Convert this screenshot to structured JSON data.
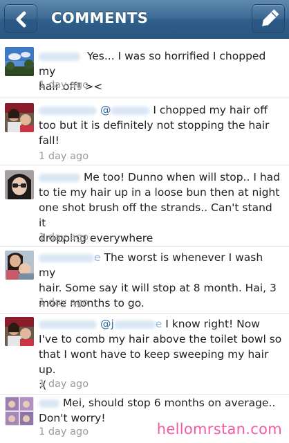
{
  "header": {
    "title": "COMMENTS",
    "back_icon": "chevron-left-icon",
    "edit_icon": "pencil-icon"
  },
  "colors": {
    "nav_bar": "#3b6a95",
    "timestamp": "#9a9a9a",
    "mention": "#2f6aa5",
    "watermark": "#f15aa6"
  },
  "comments": [
    {
      "text_lines": [
        "Yes... I was so horrified I chopped my",
        "hair off! ><"
      ],
      "time": "1 day ago"
    },
    {
      "mention": "@",
      "text_lines": [
        "I chopped my hair off",
        "too but it is definitely not stopping the hair",
        "fall!"
      ],
      "time": "1 day ago"
    },
    {
      "text_lines": [
        "Me too! Dunno when will stop.. I had",
        "to tie my hair up in a loose bun then at night",
        "one shot brush off the strands.. Can't stand it",
        "dropping everywhere"
      ],
      "time": "1 day ago"
    },
    {
      "name_suffix": "e",
      "text_lines": [
        "The worst is whenever I wash my",
        "hair.  Some say it will stop at 8 month. Hai, 3",
        "more months to go."
      ],
      "time": "1 day ago"
    },
    {
      "mention": "@j",
      "name_suffix": "e",
      "text_lines": [
        "I know right! Now",
        "I've to comb my hair above the toilet bowl so",
        "that I wont have to keep sweeping my hair up.",
        ":("
      ],
      "time": "1 day ago"
    },
    {
      "text_lines": [
        "Mei, should stop 6 months on average..",
        "Don't worry!"
      ],
      "time": "1 day ago"
    }
  ],
  "watermark": "hellomrstan.com"
}
